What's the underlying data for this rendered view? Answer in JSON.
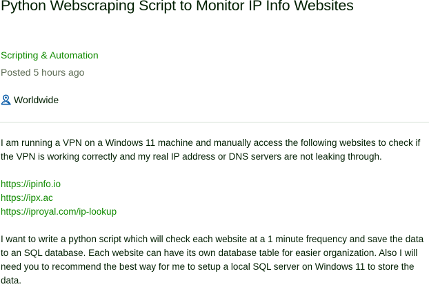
{
  "job": {
    "title": "Python Webscraping Script to Monitor IP Info Websites",
    "category": "Scripting & Automation",
    "posted": "Posted 5 hours ago",
    "location": "Worldwide",
    "location_icon": "location-pin-icon",
    "description": {
      "intro": "I am running a VPN on a Windows 11 machine and manually access the following websites to check if the VPN is working correctly and my real IP address or DNS servers are not leaking through.",
      "links": [
        "https://ipinfo.io",
        "https://ipx.ac",
        "https://iproyal.com/ip-lookup"
      ],
      "body": "I want to write a python script which will check each website at a 1 minute frequency and save the data to an SQL database. Each website can have its own database table for easier organization. Also I will need you to recommend the best way for me to setup a local SQL server on Windows 11 to store the data."
    }
  },
  "colors": {
    "link": "#108a00",
    "text": "#001e00",
    "muted": "#5e6d55",
    "divider": "#d5e0d5"
  }
}
